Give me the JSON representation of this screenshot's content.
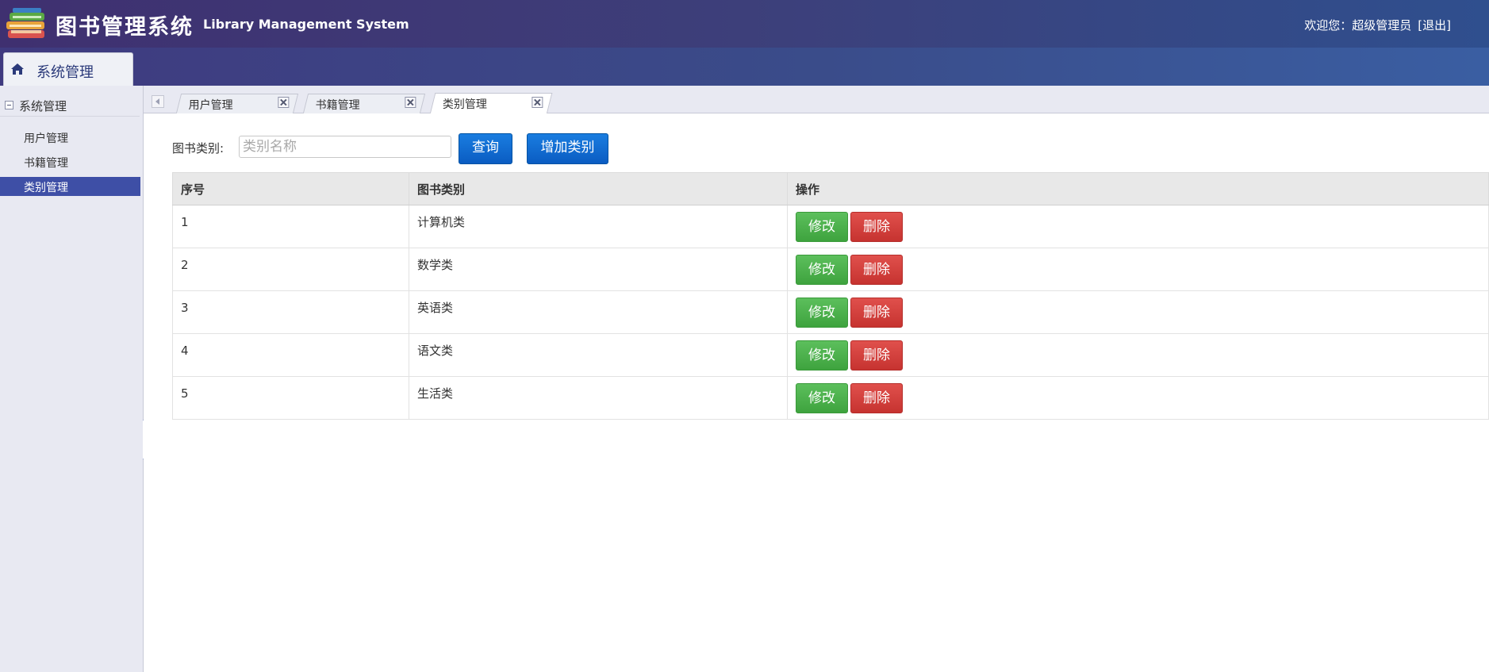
{
  "header": {
    "title": "图书管理系统",
    "subtitle": "Library Management System",
    "welcome_prefix": "欢迎您：",
    "user": "超级管理员",
    "logout": "[退出]"
  },
  "band": {
    "tab_label": "系统管理"
  },
  "sidebar": {
    "group_label": "系统管理",
    "items": [
      {
        "label": "用户管理",
        "active": false
      },
      {
        "label": "书籍管理",
        "active": false
      },
      {
        "label": "类别管理",
        "active": true
      }
    ]
  },
  "tabs": [
    {
      "label": "用户管理",
      "active": false
    },
    {
      "label": "书籍管理",
      "active": false
    },
    {
      "label": "类别管理",
      "active": true
    }
  ],
  "search": {
    "label": "图书类别:",
    "placeholder": "类别名称",
    "value": "",
    "query_button": "查询",
    "add_button": "增加类别"
  },
  "table": {
    "columns": [
      "序号",
      "图书类别",
      "操作"
    ],
    "edit_label": "修改",
    "delete_label": "删除",
    "rows": [
      {
        "id": "1",
        "category": "计算机类"
      },
      {
        "id": "2",
        "category": "数学类"
      },
      {
        "id": "3",
        "category": "英语类"
      },
      {
        "id": "4",
        "category": "语文类"
      },
      {
        "id": "5",
        "category": "生活类"
      }
    ]
  },
  "colors": {
    "header_bg": "#3f3070",
    "sidebar_active": "#3e4fa6",
    "primary_button": "#0a5cc2",
    "edit_button": "#3ea33e",
    "delete_button": "#c63330"
  }
}
